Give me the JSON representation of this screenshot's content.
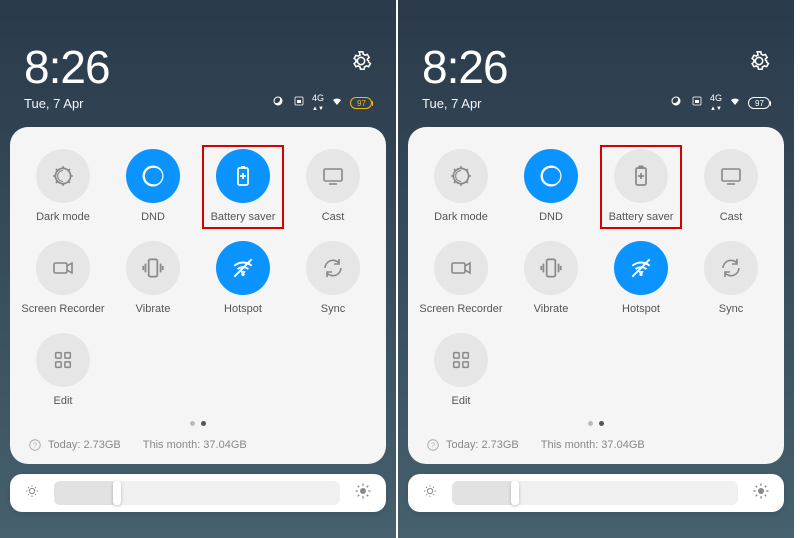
{
  "time": "8:26",
  "date": "Tue, 7 Apr",
  "battery_level": "97",
  "tiles": [
    {
      "id": "dark-mode",
      "label": "Dark mode"
    },
    {
      "id": "dnd",
      "label": "DND"
    },
    {
      "id": "battery-saver",
      "label": "Battery saver"
    },
    {
      "id": "cast",
      "label": "Cast"
    },
    {
      "id": "screen-recorder",
      "label": "Screen Recorder"
    },
    {
      "id": "vibrate",
      "label": "Vibrate"
    },
    {
      "id": "hotspot",
      "label": "Hotspot"
    },
    {
      "id": "sync",
      "label": "Sync"
    },
    {
      "id": "edit",
      "label": "Edit"
    }
  ],
  "data_usage": {
    "today": "Today: 2.73GB",
    "month": "This month: 37.04GB"
  },
  "screens": [
    {
      "active_tiles": [
        "dnd",
        "battery-saver",
        "hotspot"
      ]
    },
    {
      "active_tiles": [
        "dnd",
        "hotspot"
      ]
    }
  ]
}
